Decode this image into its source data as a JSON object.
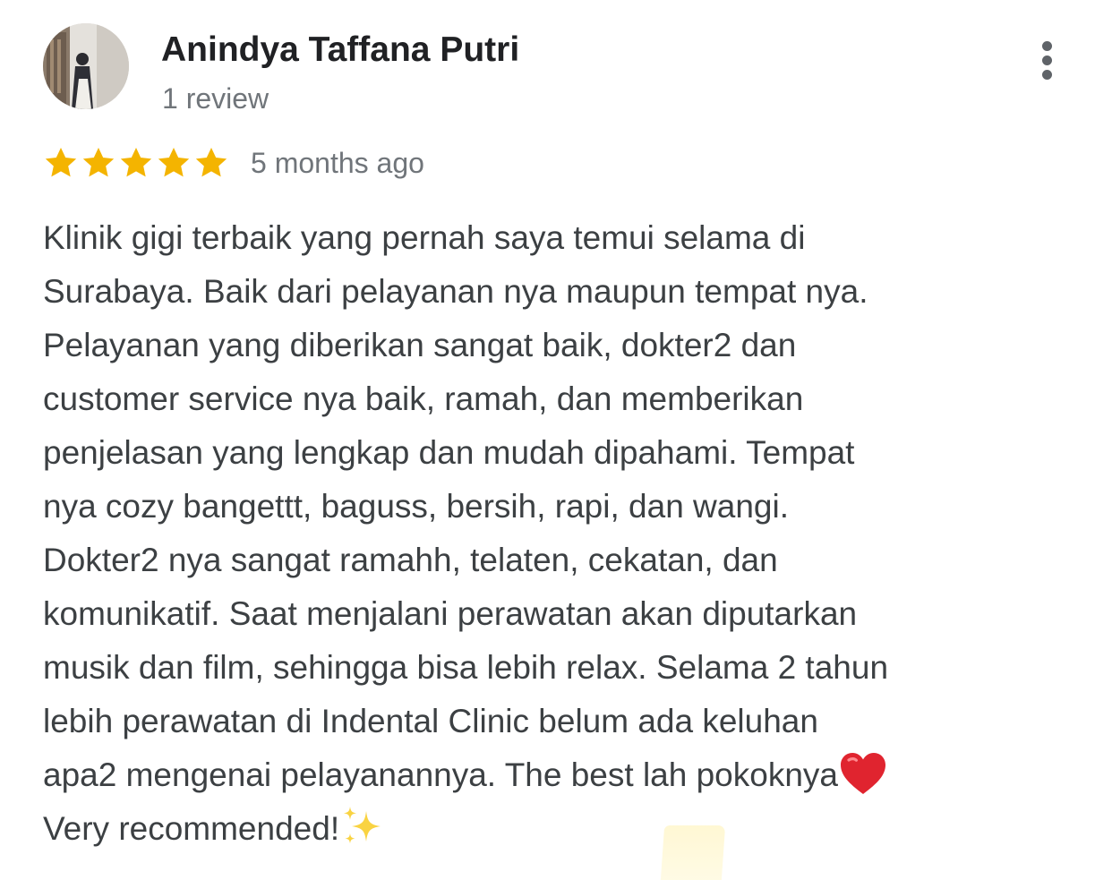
{
  "reviewer": {
    "name": "Anindya Taffana Putri",
    "review_count": "1 review",
    "avatar_icon": "profile-photo-icon"
  },
  "rating": {
    "stars": 5,
    "max_stars": 5,
    "star_color": "#F4B400"
  },
  "review": {
    "date": "5 months ago",
    "lines": [
      "Klinik gigi terbaik yang pernah saya temui selama di",
      "Surabaya. Baik dari pelayanan nya maupun tempat nya.",
      "Pelayanan yang diberikan sangat baik, dokter2 dan",
      "customer service nya baik, ramah, dan memberikan",
      "penjelasan yang lengkap dan mudah dipahami. Tempat",
      "nya cozy bangettt, baguss, bersih, rapi, dan wangi.",
      "Dokter2 nya sangat ramahh, telaten, cekatan, dan",
      "komunikatif. Saat menjalani perawatan akan diputarkan",
      "musik dan film, sehingga bisa lebih relax. Selama 2 tahun",
      "lebih perawatan di Indental Clinic belum ada keluhan",
      "apa2 mengenai pelayanannya. The best lah pokoknya",
      "Very recommended!"
    ],
    "emoji_after_line_11": "heart-emoji-icon",
    "emoji_after_line_12": "sparkles-emoji-icon"
  },
  "menu": {
    "icon": "more-vert-icon"
  },
  "colors": {
    "name_text": "#202124",
    "secondary_text": "#70757a",
    "body_text": "#3c4043",
    "heart": "#e0242f",
    "sparkle": "#f9d342"
  }
}
